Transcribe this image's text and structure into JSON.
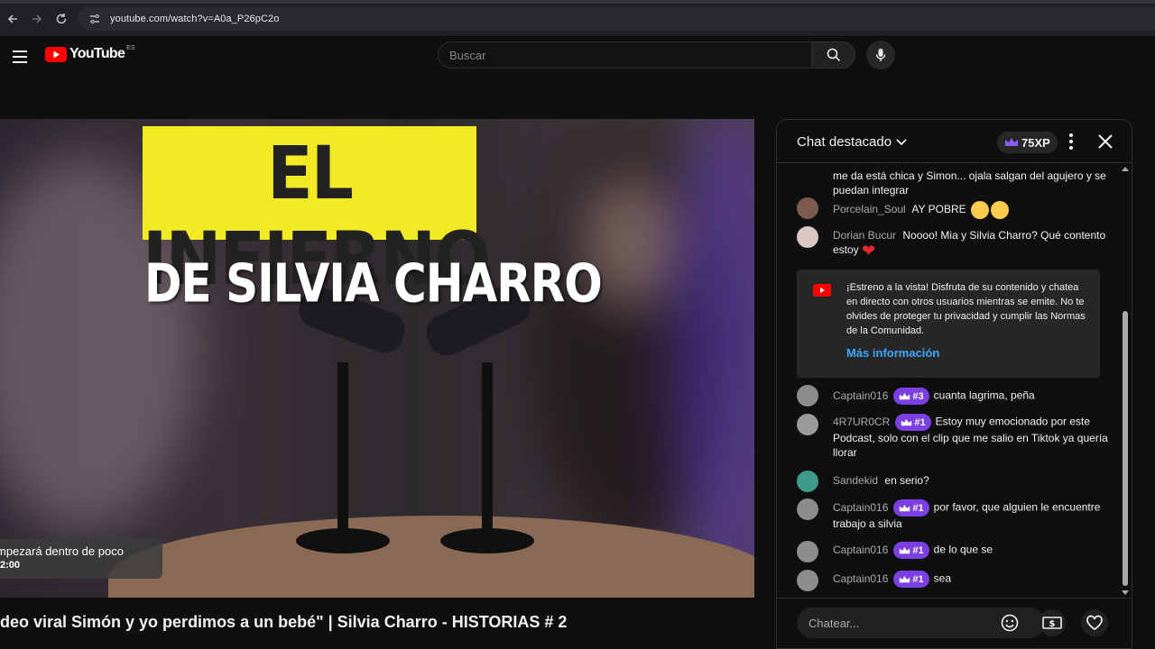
{
  "browser": {
    "url": "youtube.com/watch?v=A0a_P26pC2o"
  },
  "header": {
    "logo_text": "YouTube",
    "region": "ES",
    "search_placeholder": "Buscar"
  },
  "video": {
    "thumbnail_line1": "EL INFIERNO",
    "thumbnail_line2": "DE SILVIA CHARRO",
    "premiere_text": "mpezará dentro de poco",
    "premiere_time": "2:00",
    "title": "deo viral Simón y yo perdimos a un bebé\" | Silvia Charro - HISTORIAS # 2"
  },
  "chat": {
    "title": "Chat destacado",
    "xp": "75XP",
    "messages": [
      {
        "author": "",
        "text": "me da está chica y Simon... ojala salgan del agujero y se puedan integrar"
      },
      {
        "author": "Porcelain_Soul",
        "text": "AY POBRE"
      },
      {
        "author": "Dorian Bucur",
        "text": "Noooo! Mia y Silvia Charro? Qué contento estoy"
      },
      {
        "author": "Captain016",
        "badge": "#3",
        "text": "cuanta lagrima, peña"
      },
      {
        "author": "4R7UR0CR",
        "badge": "#1",
        "text": "Estoy muy emocionado por este Podcast, solo con el clip que me salio en Tiktok ya quería llorar"
      },
      {
        "author": "Sandekid",
        "text": "en serio?"
      },
      {
        "author": "Captain016",
        "badge": "#1",
        "text": "por favor, que alguien le encuentre trabajo a silvia"
      },
      {
        "author": "Captain016",
        "badge": "#1",
        "text": "de lo que se"
      },
      {
        "author": "Captain016",
        "badge": "#1",
        "text": "sea"
      }
    ],
    "notice": {
      "text": "¡Estreno a la vista! Disfruta de su contenido y chatea en directo con otros usuarios mientras se emite. No te olvides de proteger tu privacidad y cumplir las Normas de la Comunidad.",
      "link": "Más información"
    },
    "input_placeholder": "Chatear..."
  },
  "colors": {
    "accent_link": "#3ea6ff",
    "badge_purple": "#7b3fe4",
    "youtube_red": "#ff0000",
    "thumbnail_yellow": "#f2ea25"
  }
}
